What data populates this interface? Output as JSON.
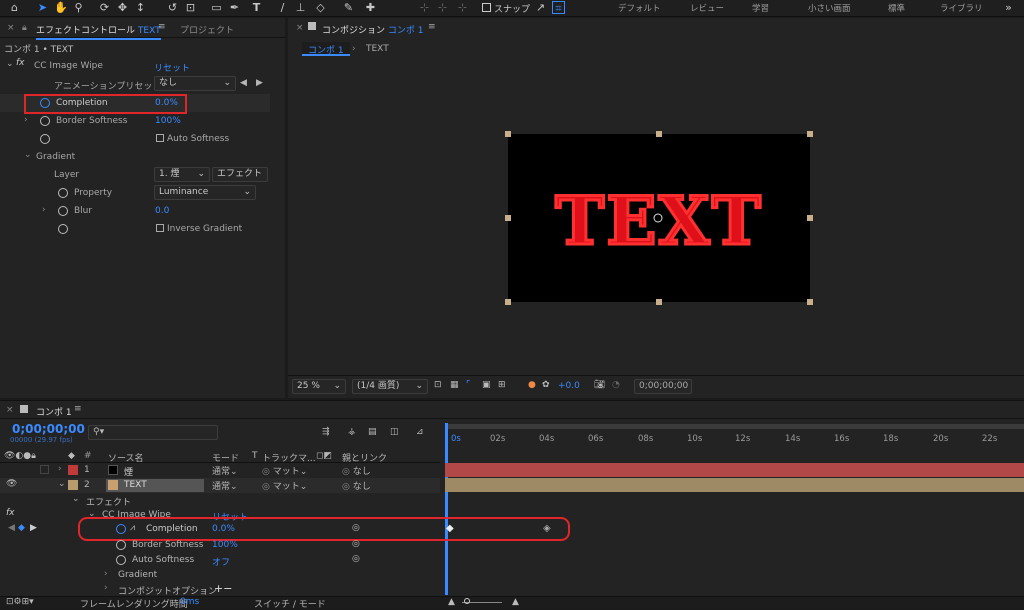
{
  "workspaces": [
    "デフォルト",
    "レビュー",
    "学習",
    "小さい画面",
    "標準",
    "ライブラリ"
  ],
  "toolbar": {
    "snap": "スナップ"
  },
  "left": {
    "tab_effect": "エフェクトコントロール",
    "tab_effect_suffix": "TEXT",
    "tab_project": "プロジェクト",
    "comp_path": "コンポ 1 • TEXT",
    "effect": {
      "fx": "fx",
      "name": "CC Image Wipe",
      "reset": "リセット",
      "preset_label": "アニメーションプリセット",
      "preset_value": "なし",
      "completion_label": "Completion",
      "completion_value": "0.0",
      "completion_unit": "%",
      "border_label": "Border Softness",
      "border_value": "100",
      "border_unit": "%",
      "auto_softness": "Auto Softness",
      "gradient": "Gradient",
      "layer_label": "Layer",
      "layer_value": "1. 煙",
      "layer_mode": "エフェクト",
      "property_label": "Property",
      "property_value": "Luminance",
      "blur_label": "Blur",
      "blur_value": "0.0",
      "inverse": "Inverse Gradient"
    }
  },
  "viewer": {
    "tab_label": "コンポジション",
    "tab_name": "コンポ 1",
    "crumb1": "コンポ 1",
    "crumb2": "TEXT",
    "canvas_text": "TEXT",
    "zoom": "25 %",
    "resolution": "(1/4 画質)",
    "exposure": "+0.0",
    "timecode": "0;00;00;00"
  },
  "timeline": {
    "tab": "コンポ 1",
    "timecode": "0;00;00;00",
    "fps": "00000 (29.97 fps)",
    "search_placeholder": "",
    "col_source": "ソース名",
    "col_mode": "モード",
    "col_t": "T",
    "col_track": "トラックマ...",
    "col_parent": "親とリンク",
    "layers": [
      {
        "num": "1",
        "name": "煙",
        "mode": "通常",
        "matte": "マット",
        "parent": "なし",
        "color": "#c03a3a"
      },
      {
        "num": "2",
        "name": "TEXT",
        "mode": "通常",
        "matte": "マット",
        "parent": "なし",
        "color": "#b89c6c"
      }
    ],
    "effects": "エフェクト",
    "effect_name": "CC Image Wipe",
    "effect_reset": "リセット",
    "completion": "Completion",
    "completion_value": "0.0",
    "completion_unit": "%",
    "border": "Border Softness",
    "border_value": "100",
    "border_unit": "%",
    "auto": "Auto Softness",
    "auto_value": "オフ",
    "gradient": "Gradient",
    "composite": "コンポジットオプション",
    "ticks": [
      "0s",
      "02s",
      "04s",
      "06s",
      "08s",
      "10s",
      "12s",
      "14s",
      "16s",
      "18s",
      "20s",
      "22s"
    ],
    "footer_render": "フレームレンダリング時間",
    "footer_ms": "0ms",
    "footer_switch": "スイッチ / モード"
  },
  "colors": {
    "accent": "#3a8bff",
    "highlight": "#e0262a",
    "text_fill": "#e0101a"
  }
}
